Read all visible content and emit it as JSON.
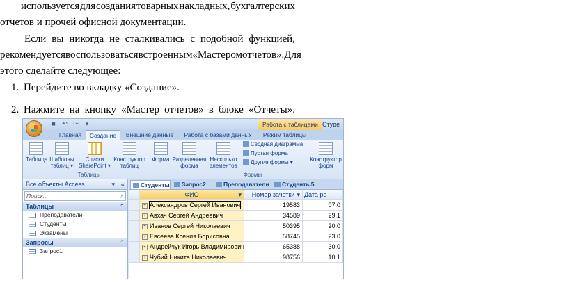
{
  "doc": {
    "line1": [
      "используется",
      "для",
      "создания",
      "товарных",
      "накладных,",
      "бухгалтерских"
    ],
    "line2": "отчетов и прочей офисной документации.",
    "line3": [
      "Если",
      "вы",
      "никогда",
      "не",
      "сталкивались",
      "с",
      "подобной",
      "функцией,"
    ],
    "line4": [
      "рекомендуется",
      "воспользоваться",
      "встроенным",
      "«Мастером",
      "отчетов».",
      "Для"
    ],
    "line5": "этого сделайте следующее:",
    "step1_num": "1.",
    "step1": "Перейдите во вкладку «Создание».",
    "step2_num": "2.",
    "step2": [
      "Нажмите",
      "на",
      "кнопку",
      "«Мастер",
      "отчетов»",
      "в",
      "блоке",
      "«Отчеты»."
    ]
  },
  "access": {
    "context_tab": "Работа с таблицами",
    "app_title": "Студе",
    "tabs": [
      "Главная",
      "Создание",
      "Внешние данные",
      "Работа с базами данных",
      "Режим таблицы"
    ],
    "active_tab": "Создание",
    "ribbon": {
      "table": "Таблица",
      "templates": "Шаблоны\nтаблиц ▾",
      "lists": "Списки\nSharePoint ▾",
      "designer": "Конструктор\nтаблиц",
      "form": "Форма",
      "split_form": "Разделенная\nформа",
      "multi": "Несколько\nэлементов",
      "pivot_chart": "Сводная диаграмма",
      "blank_form": "Пустая форма",
      "other_forms": "Другие формы ▾",
      "form_designer": "Конструктор\nформ",
      "group_tables": "Таблицы",
      "group_forms": "Формы"
    },
    "nav": {
      "header": "Все объекты Access",
      "search_placeholder": "Поиск...",
      "group_tables": "Таблицы",
      "tables": [
        "Преподаватели",
        "Студенты",
        "Экзамены"
      ],
      "group_queries": "Запросы",
      "queries": [
        "Запрос1"
      ]
    },
    "doc_tabs": [
      "Студенты",
      "Запрос2",
      "Преподаватели",
      "Студенты5"
    ],
    "grid": {
      "headers": [
        "ФИО",
        "Номер зачетки",
        "Дата ро"
      ],
      "rows": [
        [
          "Александров Сергей Иванович",
          "19583",
          "07.0"
        ],
        [
          "Авхач Сергей Андреевич",
          "34589",
          "29.1"
        ],
        [
          "Иванов Сергей Николаевич",
          "50395",
          "20.0"
        ],
        [
          "Евсеева Ксения Борисовна",
          "58745",
          "23.0"
        ],
        [
          "Андрейчук Игорь Владимирович",
          "65388",
          "30.0"
        ],
        [
          "Чубий Никита Николаевич",
          "98756",
          "10.1"
        ]
      ]
    }
  }
}
